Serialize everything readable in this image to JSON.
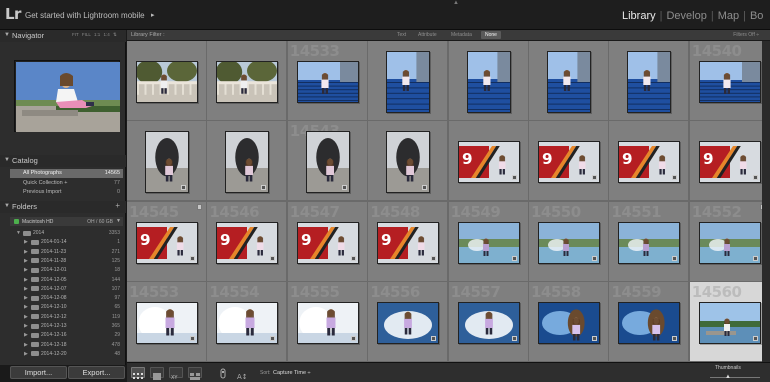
{
  "app": {
    "logo": "Lr",
    "mobile_prompt": "Get started with Lightroom mobile",
    "mobile_arrow": "▸",
    "top_arrow": "▲",
    "modules": [
      "Library",
      "Develop",
      "Map",
      "Bo"
    ],
    "active_module": "Library"
  },
  "navigator": {
    "title": "Navigator",
    "zoom_options": "FIT  FILL  1:1  1:4  ⇅"
  },
  "catalog": {
    "title": "Catalog",
    "rows": [
      {
        "label": "All Photographs",
        "count": "14565",
        "selected": true
      },
      {
        "label": "Quick Collection +",
        "count": "77",
        "selected": false
      },
      {
        "label": "Previous Import",
        "count": "0",
        "selected": false
      }
    ]
  },
  "folders": {
    "title": "Folders",
    "add_label": "+",
    "volume": {
      "name": "Macintosh HD",
      "space": "OH / 60 GB"
    },
    "rows": [
      {
        "label": "2014",
        "count": "3353",
        "level": 1
      },
      {
        "label": "2014-01-14",
        "count": "1",
        "level": 2
      },
      {
        "label": "2014-11-23",
        "count": "271",
        "level": 2
      },
      {
        "label": "2014-11-28",
        "count": "125",
        "level": 2
      },
      {
        "label": "2014-12-01",
        "count": "18",
        "level": 2
      },
      {
        "label": "2014-12-05",
        "count": "144",
        "level": 2
      },
      {
        "label": "2014-12-07",
        "count": "107",
        "level": 2
      },
      {
        "label": "2014-12-08",
        "count": "97",
        "level": 2
      },
      {
        "label": "2014-12-10",
        "count": "65",
        "level": 2
      },
      {
        "label": "2014-12-12",
        "count": "119",
        "level": 2
      },
      {
        "label": "2014-12-13",
        "count": "365",
        "level": 2
      },
      {
        "label": "2014-12-16",
        "count": "29",
        "level": 2
      },
      {
        "label": "2014-12-18",
        "count": "478",
        "level": 2
      },
      {
        "label": "2014-12-20",
        "count": "48",
        "level": 2
      }
    ]
  },
  "buttons": {
    "import": "Import...",
    "export": "Export..."
  },
  "filter_bar": {
    "title": "Library Filter :",
    "options": [
      "Text",
      "Attribute",
      "Metadata",
      "None"
    ],
    "active": "None",
    "filters_off": "Filters Off ÷"
  },
  "grid": {
    "cells": [
      {
        "num": "",
        "scene": "balustrade",
        "orient": "land"
      },
      {
        "num": "",
        "scene": "balustrade",
        "orient": "land"
      },
      {
        "num": "14533",
        "scene": "stadium",
        "orient": "land"
      },
      {
        "num": "",
        "scene": "stadium",
        "orient": "port"
      },
      {
        "num": "",
        "scene": "stadium",
        "orient": "port"
      },
      {
        "num": "",
        "scene": "stadium",
        "orient": "port"
      },
      {
        "num": "",
        "scene": "stadium",
        "orient": "port"
      },
      {
        "num": "14540",
        "scene": "stadium",
        "orient": "land"
      },
      {
        "num": "",
        "scene": "dark",
        "orient": "port"
      },
      {
        "num": "",
        "scene": "dark",
        "orient": "port"
      },
      {
        "num": "14543",
        "scene": "dark",
        "orient": "port"
      },
      {
        "num": "",
        "scene": "dark",
        "orient": "port"
      },
      {
        "num": "",
        "scene": "poster",
        "orient": "land"
      },
      {
        "num": "",
        "scene": "poster",
        "orient": "land"
      },
      {
        "num": "",
        "scene": "poster",
        "orient": "land"
      },
      {
        "num": "",
        "scene": "poster",
        "orient": "land"
      },
      {
        "num": "14545",
        "scene": "poster",
        "orient": "land"
      },
      {
        "num": "14546",
        "scene": "poster",
        "orient": "land"
      },
      {
        "num": "14547",
        "scene": "poster",
        "orient": "land"
      },
      {
        "num": "14548",
        "scene": "poster",
        "orient": "land"
      },
      {
        "num": "14549",
        "scene": "fountain",
        "orient": "land"
      },
      {
        "num": "14550",
        "scene": "fountain",
        "orient": "land"
      },
      {
        "num": "14551",
        "scene": "fountain",
        "orient": "land"
      },
      {
        "num": "14552",
        "scene": "fountain",
        "orient": "land"
      },
      {
        "num": "14553",
        "scene": "white",
        "orient": "land"
      },
      {
        "num": "14554",
        "scene": "white",
        "orient": "land"
      },
      {
        "num": "14555",
        "scene": "white",
        "orient": "land"
      },
      {
        "num": "14556",
        "scene": "splash",
        "orient": "land"
      },
      {
        "num": "14557",
        "scene": "splash",
        "orient": "land"
      },
      {
        "num": "14558",
        "scene": "blue",
        "orient": "land"
      },
      {
        "num": "14559",
        "scene": "blue",
        "orient": "land"
      },
      {
        "num": "14560",
        "scene": "lake",
        "orient": "land",
        "selected": true
      }
    ]
  },
  "toolbar": {
    "sort_label": "Sort:",
    "sort_value": "Capture Time ÷",
    "thumbnails_label": "Thumbnails",
    "thumbnail_knob": "▲"
  }
}
